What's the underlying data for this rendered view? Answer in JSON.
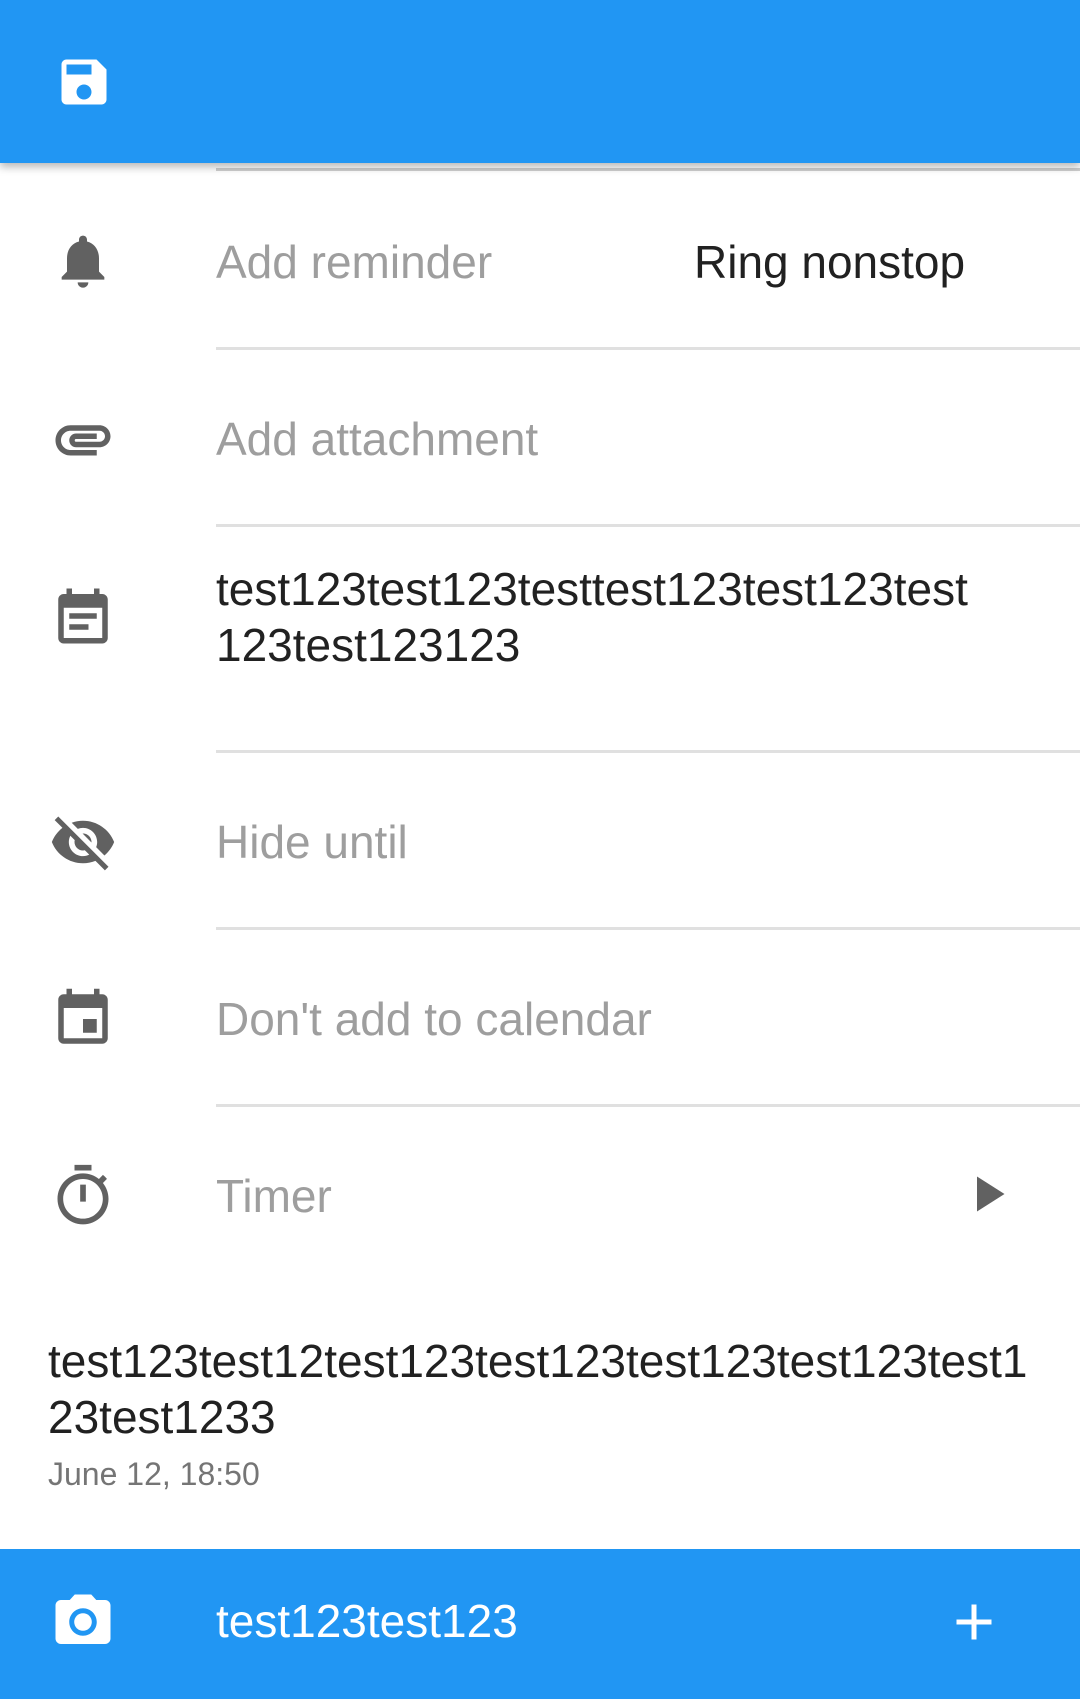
{
  "colors": {
    "primary": "#2196F3",
    "icon_gray": "#616161",
    "hint_gray": "#9e9e9e",
    "text_dark": "#212121"
  },
  "toolbar": {
    "save_icon": "save-icon"
  },
  "rows": {
    "reminder": {
      "icon": "bell-icon",
      "label": "Add reminder",
      "mode": "Ring nonstop"
    },
    "attachment": {
      "icon": "paperclip-icon",
      "label": "Add attachment"
    },
    "description": {
      "icon": "notes-icon",
      "text": "test123test123testtest123test123test123test123123"
    },
    "hide_until": {
      "icon": "eye-off-icon",
      "label": "Hide until"
    },
    "calendar": {
      "icon": "calendar-icon",
      "label": "Don't add to calendar"
    },
    "timer": {
      "icon": "stopwatch-icon",
      "label": "Timer",
      "play_icon": "play-icon"
    }
  },
  "comment": {
    "text": "test123test12test123test123test123test123test123test1233",
    "date": "June 12, 18:50"
  },
  "comment_bar": {
    "camera_icon": "camera-icon",
    "input_value": "test123test123",
    "add_icon": "plus-icon"
  }
}
